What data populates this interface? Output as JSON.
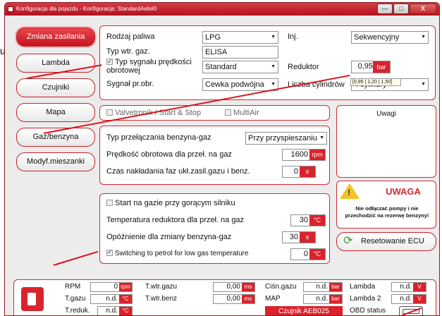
{
  "window": {
    "title": "Konfiguracja dla pojazdu - Konfiguracja: StandardAeb#0",
    "minimize": "—",
    "maximize": "□",
    "close": "X"
  },
  "side_text": "u",
  "nav": {
    "items": [
      {
        "label": "Zmiana zasilania",
        "active": true
      },
      {
        "label": "Lambda"
      },
      {
        "label": "Czujniki"
      },
      {
        "label": "Mapa"
      },
      {
        "label": "Gaz/benzyna"
      },
      {
        "label": "Modyf.mieszanki"
      }
    ]
  },
  "fuel": {
    "fuel_type_label": "Rodzaj paliwa",
    "fuel_type_value": "LPG",
    "inj_label": "Inj.",
    "inj_value": "Sekwencyjny",
    "injector_type_label": "Typ wtr. gaz.",
    "injector_type_value": "ELISA",
    "rpm_signal_check_label": "Typ sygnału prędkości obrotowej",
    "rpm_signal_value": "Standard",
    "reducer_label": "Reduktor",
    "reducer_value": "0,95",
    "reducer_unit": "bar",
    "reducer_tooltip": "[0,95 | 1,20 | 1,50]",
    "rpm_signal_label": "Sygnał pr.obr.",
    "rpm_signal_source": "Cewka podwójna",
    "cylinders_label": "Liczba cylindrów",
    "cylinders_value": "4 cylindry"
  },
  "options": {
    "valvetronic_label": "Valvetronik / Start & Stop",
    "multiair_label": "MultiAir"
  },
  "switching": {
    "type_label": "Typ przełączania benzyna-gaz",
    "type_value": "Przy przyspieszaniu",
    "rpm_label": "Prędkość obrotowa dla przeł. na gaz",
    "rpm_value": "1600",
    "rpm_unit": "rpm",
    "overlap_label": "Czas nakładania faz ukł.zasil.gazu i benz.",
    "overlap_value": "0",
    "overlap_unit": "s"
  },
  "hot_start": {
    "start_hot_label": "Start na gazie przy gorącym silniku",
    "reducer_temp_label": "Temperatura reduktora dla przeł. na gaz",
    "reducer_temp_value": "30",
    "reducer_temp_unit": "°C",
    "delay_label": "Opóźnienie dla zmiany benzyna-gaz",
    "delay_value": "30",
    "delay_unit": "s",
    "low_temp_label": "Switching to petrol for low gas temperature",
    "low_temp_value": "0",
    "low_temp_unit": "°C"
  },
  "notes": {
    "title": "Uwagi"
  },
  "warning": {
    "title": "UWAGA",
    "text": "Nie odłączać pompy i nie przechodzić na rezerwę benzyny!"
  },
  "reset_button": "Resetowanie ECU",
  "status": {
    "rpm_label": "RPM",
    "rpm_value": "0",
    "rpm_unit": "rpm",
    "tgas_label": "T.gazu",
    "tgas_value": "n.d.",
    "tgas_unit": "°C",
    "tred_label": "T.reduk.",
    "tred_value": "n.d.",
    "tred_unit": "°C",
    "twtrgaz_label": "T.wtr.gazu",
    "twtrgaz_value": "0,00",
    "twtrgaz_unit": "ms",
    "twtrbenz_label": "T.wtr.benz",
    "twtrbenz_value": "0,00",
    "twtrbenz_unit": "ms",
    "pgas_label": "Ciśn.gazu",
    "pgas_value": "n.d.",
    "pgas_unit": "bar",
    "map_label": "MAP",
    "map_value": "n.d.",
    "map_unit": "bar",
    "sensor_label": "Czujnik AEB025",
    "lambda_label": "Lambda",
    "lambda_value": "n.d.",
    "lambda_unit": "V",
    "lambda2_label": "Lambda 2",
    "lambda2_value": "n.d.",
    "lambda2_unit": "V",
    "obd_label": "OBD status"
  },
  "colors": {
    "accent": "#d9232c",
    "annotation_line": "#d9141e"
  }
}
